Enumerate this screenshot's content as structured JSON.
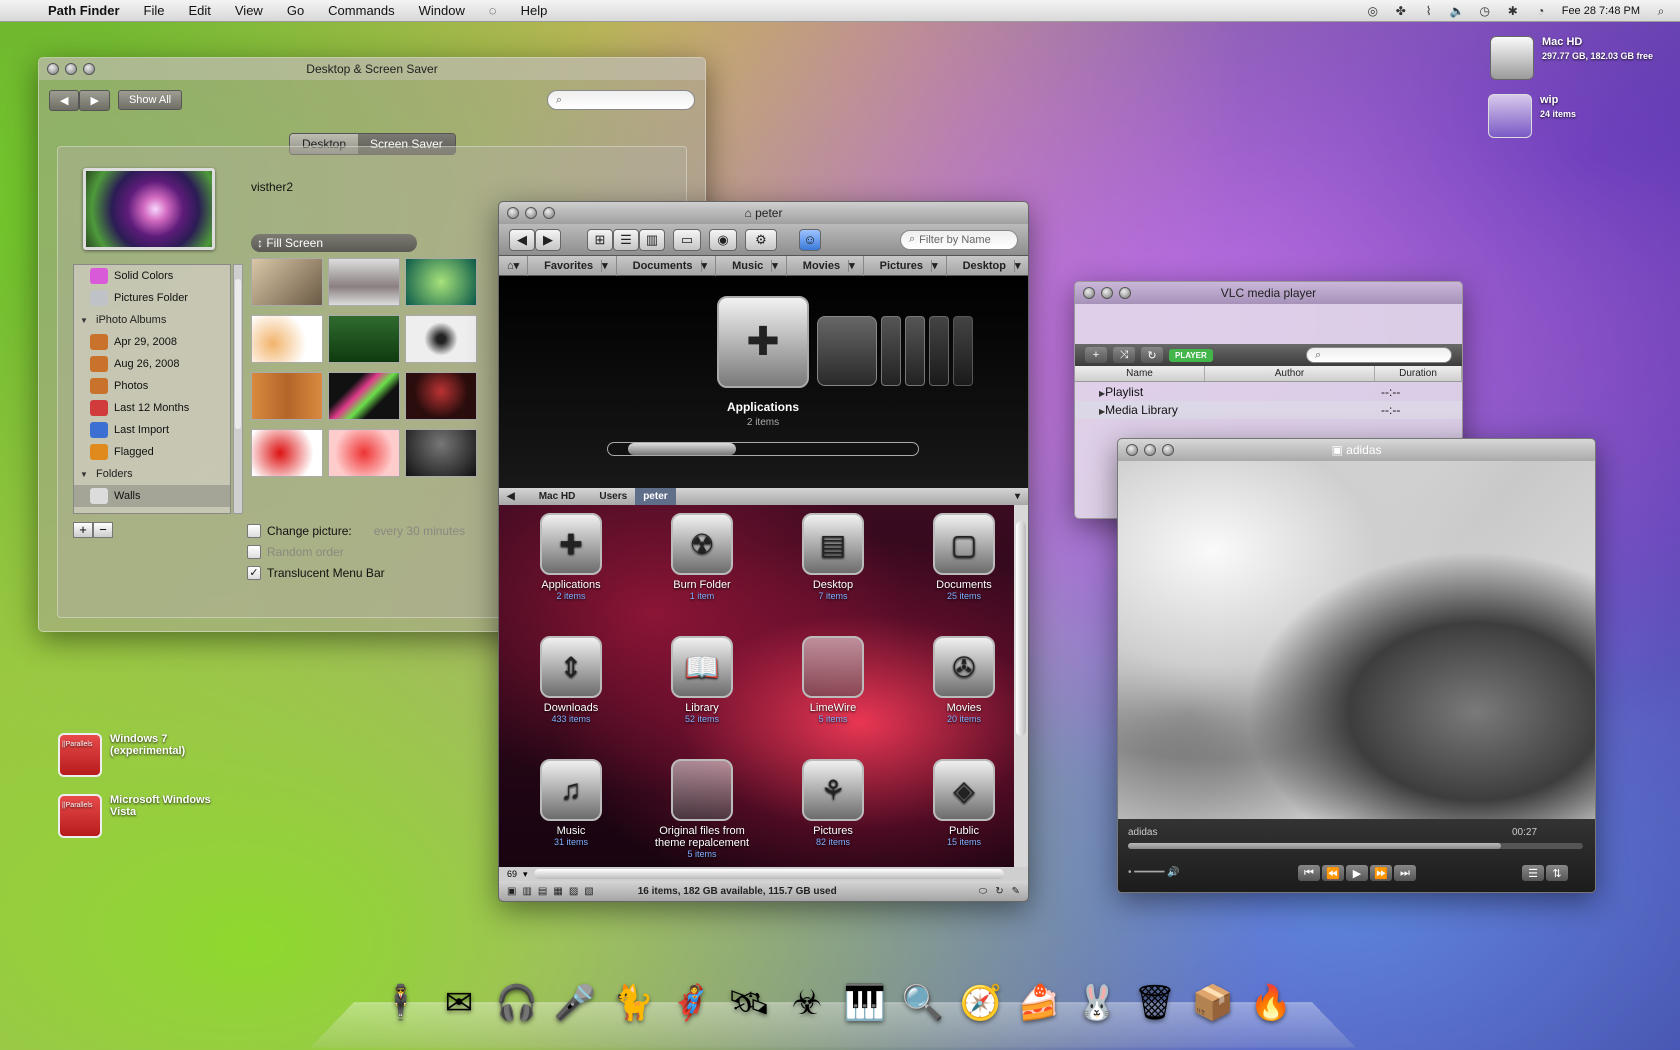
{
  "menubar": {
    "app": "Path Finder",
    "items": [
      "File",
      "Edit",
      "View",
      "Go",
      "Commands",
      "Window",
      "Help"
    ],
    "clock": "Fee 28 7:48 PM"
  },
  "desktop_icons": {
    "machd": {
      "name": "Mac HD",
      "info": "297.77 GB, 182.03 GB free"
    },
    "wip": {
      "name": "wip",
      "info": "24 items"
    },
    "win7": {
      "line1": "Windows 7",
      "line2": "(experimental)",
      "badge": "||Parallels"
    },
    "vista": {
      "line1": "Microsoft Windows",
      "line2": "Vista",
      "badge": "||Parallels"
    }
  },
  "dss": {
    "title": "Desktop & Screen Saver",
    "show_all": "Show All",
    "tabs": [
      "Desktop",
      "Screen Saver"
    ],
    "active_tab": "Screen Saver",
    "picture_name": "visther2",
    "fit_option": "Fill Screen",
    "sources": [
      {
        "label": "Solid Colors",
        "type": "item",
        "color": "#d85ad8"
      },
      {
        "label": "Pictures Folder",
        "type": "item",
        "color": "#bfc3c8"
      },
      {
        "label": "iPhoto Albums",
        "type": "head"
      },
      {
        "label": "Apr 29, 2008",
        "type": "item",
        "color": "#c9722c"
      },
      {
        "label": "Aug 26, 2008",
        "type": "item",
        "color": "#c9722c"
      },
      {
        "label": "Photos",
        "type": "item",
        "color": "#c9722c"
      },
      {
        "label": "Last 12 Months",
        "type": "item",
        "color": "#d13b3b"
      },
      {
        "label": "Last Import",
        "type": "item",
        "color": "#3b6fd1"
      },
      {
        "label": "Flagged",
        "type": "item",
        "color": "#e08a1e"
      },
      {
        "label": "Folders",
        "type": "head"
      },
      {
        "label": "Walls",
        "type": "item",
        "color": "#dcdcdc",
        "selected": true
      }
    ],
    "add": "+",
    "remove": "−",
    "change_picture": "Change picture:",
    "interval": "every 30 minutes",
    "random_order": "Random order",
    "translucent": "Translucent Menu Bar"
  },
  "pathfinder": {
    "title": "peter",
    "filter_placeholder": "Filter by Name",
    "bookmarks": [
      "Favorites",
      "Documents",
      "Music",
      "Movies",
      "Pictures",
      "Desktop"
    ],
    "cover_title": "Applications",
    "cover_count": "2 items",
    "path": [
      "Mac HD",
      "Users",
      "peter"
    ],
    "items": [
      {
        "name": "Applications",
        "count": "2 items",
        "glyph": "✚"
      },
      {
        "name": "Burn Folder",
        "count": "1 item",
        "glyph": "☢"
      },
      {
        "name": "Desktop",
        "count": "7 items",
        "glyph": "▤"
      },
      {
        "name": "Documents",
        "count": "25 items",
        "glyph": "▢"
      },
      {
        "name": "Downloads",
        "count": "433 items",
        "glyph": "⇕"
      },
      {
        "name": "Library",
        "count": "52 items",
        "glyph": "📖"
      },
      {
        "name": "LimeWire",
        "count": "5 items",
        "glyph": ""
      },
      {
        "name": "Movies",
        "count": "20 items",
        "glyph": "✇"
      },
      {
        "name": "Music",
        "count": "31 items",
        "glyph": "♫"
      },
      {
        "name": "Original files from theme repalcement",
        "count": "5 items",
        "glyph": ""
      },
      {
        "name": "Pictures",
        "count": "82 items",
        "glyph": "⚘"
      },
      {
        "name": "Public",
        "count": "15 items",
        "glyph": "◈"
      }
    ],
    "zoom": "69",
    "status": "16 items, 182 GB available, 115.7 GB used"
  },
  "vlc": {
    "title": "VLC media player",
    "player_badge": "PLAYER",
    "columns": [
      "Name",
      "Author",
      "Duration"
    ],
    "rows": [
      {
        "name": "Playlist",
        "duration": "--:--"
      },
      {
        "name": "Media Library",
        "duration": "--:--"
      }
    ]
  },
  "video": {
    "title": "adidas",
    "label": "adidas",
    "time": "00:27",
    "progress": 0.82
  },
  "dock": {
    "items": [
      "🕴",
      "✉",
      "🎧",
      "🎤",
      "🐈",
      "🦸",
      "🛰",
      "☣",
      "🎹",
      "🔍",
      "🧭",
      "🍰",
      "🐰",
      "🗑",
      "📦",
      "🔥"
    ]
  }
}
